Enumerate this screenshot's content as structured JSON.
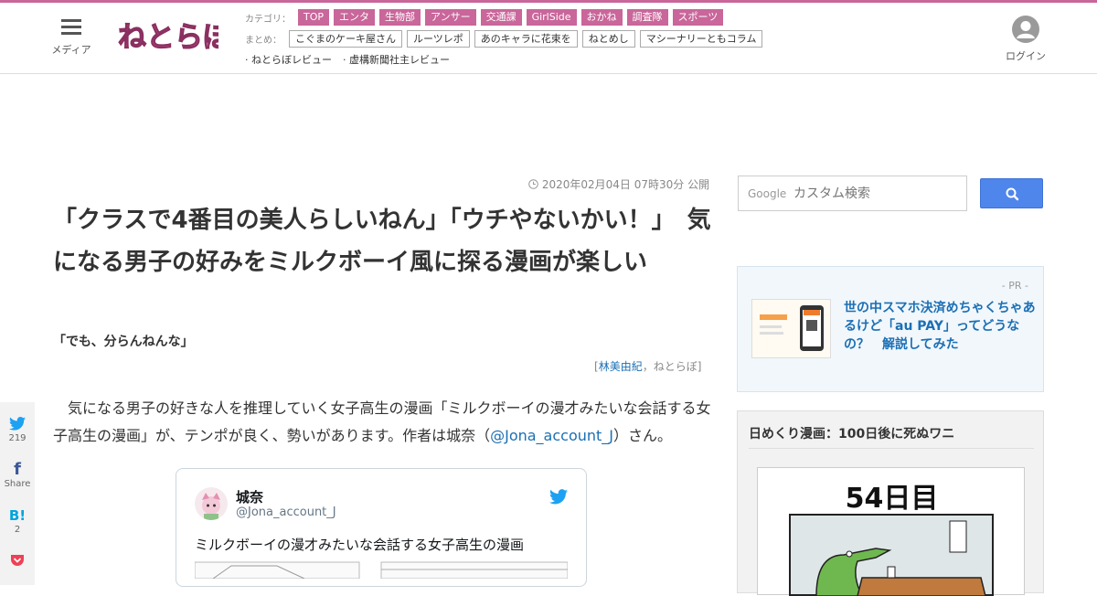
{
  "header": {
    "menu_label": "メディア",
    "login_label": "ログイン",
    "category_label": "カテゴリ：",
    "categories": [
      "TOP",
      "エンタ",
      "生物部",
      "アンサー",
      "交通課",
      "GirlSide",
      "おかね",
      "調査隊",
      "スポーツ"
    ],
    "matome_label": "まとめ：",
    "matome": [
      "こぐまのケーキ屋さん",
      "ルーツレポ",
      "あのキャラに花束を",
      "ねとめし",
      "マシーナリーともコラム"
    ],
    "reviews": [
      "· ねとらぼレビュー",
      "· 虚構新聞社主レビュー"
    ]
  },
  "article": {
    "date": "2020年02月04日 07時30分 公開",
    "title": "「クラスで4番目の美人らしいねん」「ウチやないかい！」　気になる男子の好みをミルクボーイ風に探る漫画が楽しい",
    "subtitle": "「でも、分らんねんな」",
    "byline_open": "[",
    "byline_author": "林美由紀",
    "byline_sep": "，",
    "byline_site": "ねとらぼ",
    "byline_close": "]",
    "body_before": "　気になる男子の好きな人を推理していく女子高生の漫画「ミルクボーイの漫才みたいな会話する女子高生の漫画」が、テンポが良く、勢いがあります。作者は城奈（",
    "body_link": "@Jona_account_J",
    "body_after": "）さん。"
  },
  "tweet": {
    "name": "城奈",
    "handle": "@Jona_account_J",
    "text": "ミルクボーイの漫才みたいな会話する女子高生の漫画"
  },
  "share": {
    "twitter_count": "219",
    "facebook_label": "Share",
    "hatena_label": "B!",
    "hatena_count": "2"
  },
  "sidebar": {
    "search_brand": "Google",
    "search_placeholder": "カスタム検索",
    "pr_tag": "- PR -",
    "pr_text": "世の中スマホ決済めちゃくちゃあるけど「au PAY」ってどうなの？　解説してみた",
    "comic_title": "日めくり漫画：100日後に死ぬワニ",
    "comic_day": "54日目"
  },
  "colors": {
    "brand_pink": "#c9669a",
    "link_blue": "#1b6fb5",
    "search_blue": "#4f86ec",
    "twitter_blue": "#1da1f2"
  },
  "icons": [
    "hamburger-icon",
    "user-icon",
    "clock-icon",
    "twitter-bird-icon",
    "facebook-icon",
    "pocket-icon",
    "search-icon"
  ]
}
